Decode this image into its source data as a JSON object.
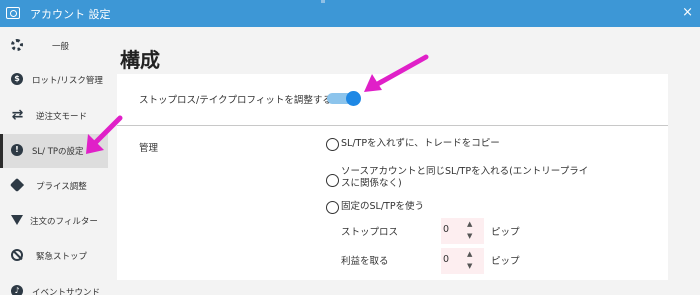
{
  "window": {
    "title": "アカウント 設定",
    "close_label": "×"
  },
  "sidebar": {
    "items": [
      {
        "label": "一般",
        "icon": "gear-icon"
      },
      {
        "label": "ロット/リスク管理",
        "icon": "dollar-icon"
      },
      {
        "label": "逆注文モード",
        "icon": "reverse-icon"
      },
      {
        "label": "SL/ TPの設定",
        "icon": "info-icon",
        "active": true
      },
      {
        "label": "プライス調整",
        "icon": "tag-icon"
      },
      {
        "label": "注文のフィルター",
        "icon": "filter-icon"
      },
      {
        "label": "緊急ストップ",
        "icon": "ban-icon"
      },
      {
        "label": "イベントサウンド",
        "icon": "sound-icon"
      }
    ]
  },
  "page": {
    "title": "構成",
    "adjust_label": "ストップロス/テイクプロフィットを調整する",
    "adjust_enabled": true,
    "management_label": "管理",
    "options": [
      {
        "label": "SL/TPを入れずに、トレードをコピー"
      },
      {
        "label_line1": "ソースアカウントと同じSL/TPを入れる(エントリープライ",
        "label_line2": "スに関係なく)"
      },
      {
        "label": "固定のSL/TPを使う"
      }
    ],
    "stop_loss": {
      "label": "ストップロス",
      "value": "0",
      "unit": "ピップ"
    },
    "take_profit": {
      "label": "利益を取る",
      "value": "0",
      "unit": "ピップ"
    }
  },
  "colors": {
    "titlebar": "#3d97d6",
    "toggle_on": "#1e88e5",
    "annotation_arrow": "#e020c8",
    "stepper_bg": "#fdeef0"
  }
}
